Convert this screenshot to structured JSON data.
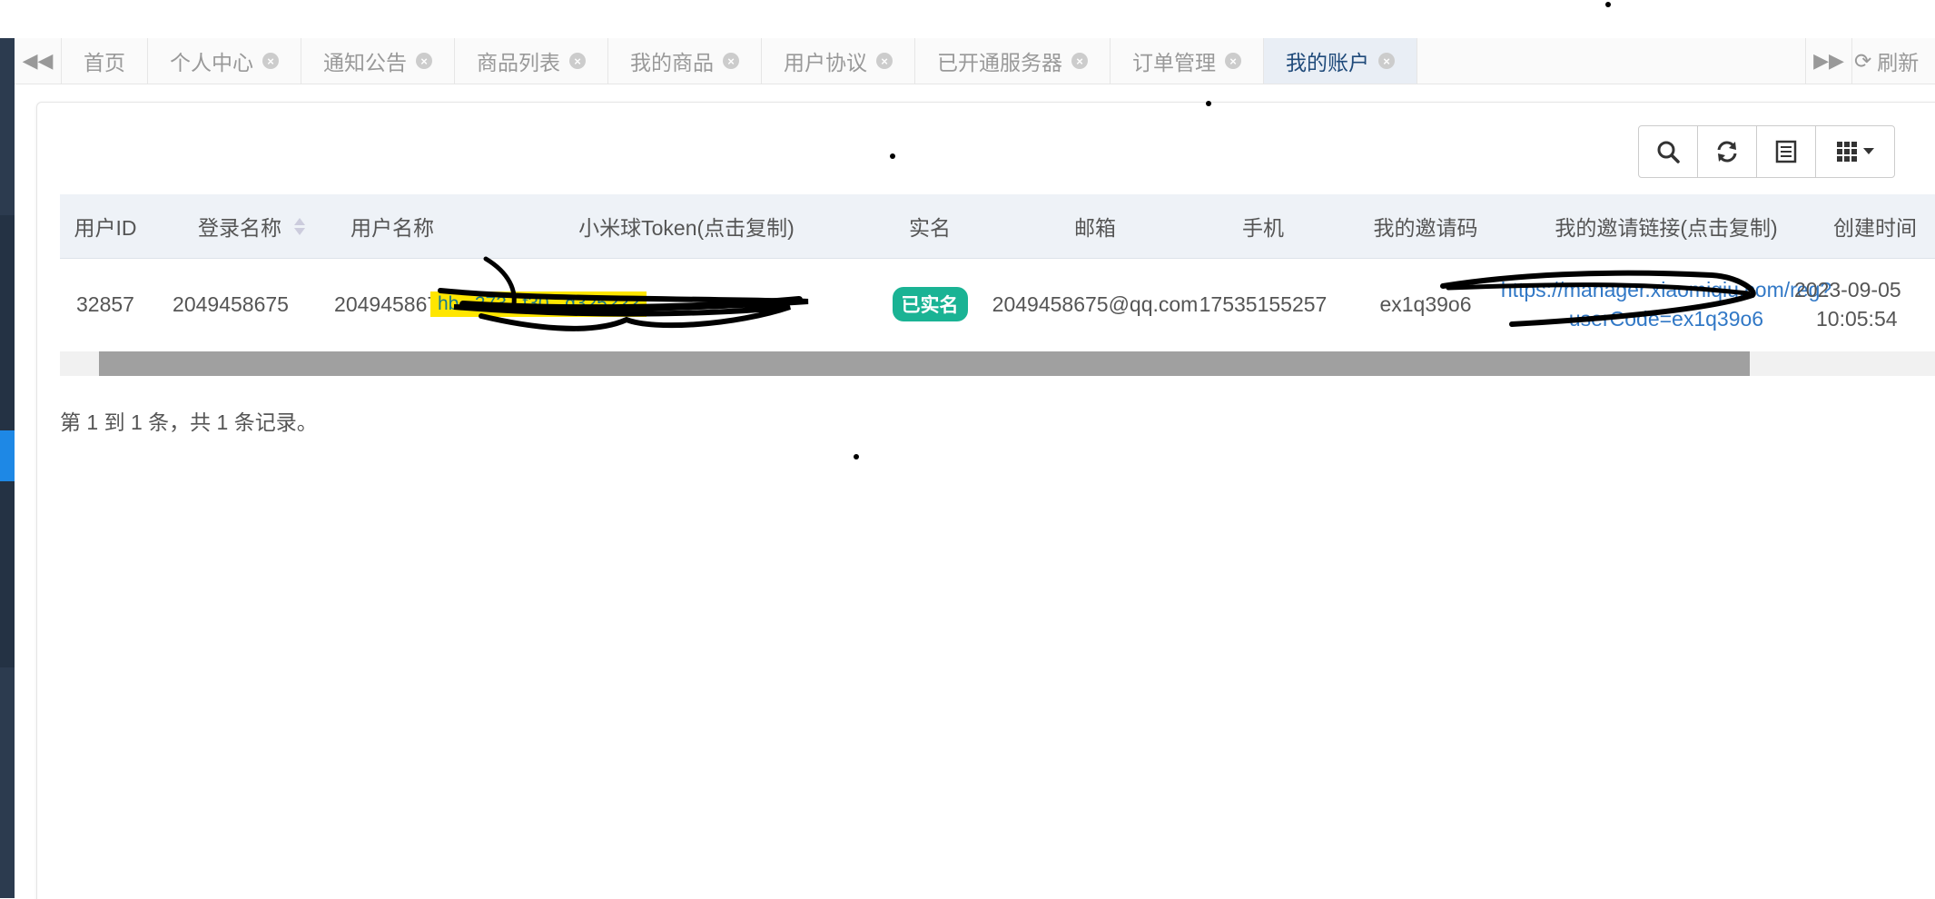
{
  "tabbar": {
    "tabs": [
      {
        "label": "首页",
        "closable": false
      },
      {
        "label": "个人中心",
        "closable": true
      },
      {
        "label": "通知公告",
        "closable": true
      },
      {
        "label": "商品列表",
        "closable": true
      },
      {
        "label": "我的商品",
        "closable": true
      },
      {
        "label": "用户协议",
        "closable": true
      },
      {
        "label": "已开通服务器",
        "closable": true
      },
      {
        "label": "订单管理",
        "closable": true
      },
      {
        "label": "我的账户",
        "closable": true,
        "active": true
      }
    ],
    "refresh_label": "刷新"
  },
  "toolbar": {
    "icons": [
      "search-icon",
      "refresh-icon",
      "list-icon",
      "columns-icon"
    ]
  },
  "table": {
    "headers": [
      "用户ID",
      "登录名称",
      "用户名称",
      "小米球Token(点击复制)",
      "实名",
      "邮箱",
      "手机",
      "我的邀请码",
      "我的邀请链接(点击复制)",
      "创建时间"
    ],
    "rows": [
      {
        "user_id": "32857",
        "login_name": "2049458675",
        "user_name": "2049458675",
        "token": "hb...373...f30...d325???",
        "realname_badge": "已实名",
        "email": "2049458675@qq.com",
        "phone": "17535155257",
        "invite_code": "ex1q39o6",
        "invite_link_line1": "https://manager.xiaomiqiu.com/reg?",
        "invite_link_line2": "userCode=ex1q39o6",
        "created_date": "2023-09-05",
        "created_time": "10:05:54"
      }
    ]
  },
  "pagination": {
    "info": "第 1 到 1 条，共 1 条记录。"
  },
  "colors": {
    "accent": "#1f4a7a",
    "badge_green": "#1ab394",
    "link_blue": "#3178c6",
    "highlight_yellow": "#ffe600"
  }
}
